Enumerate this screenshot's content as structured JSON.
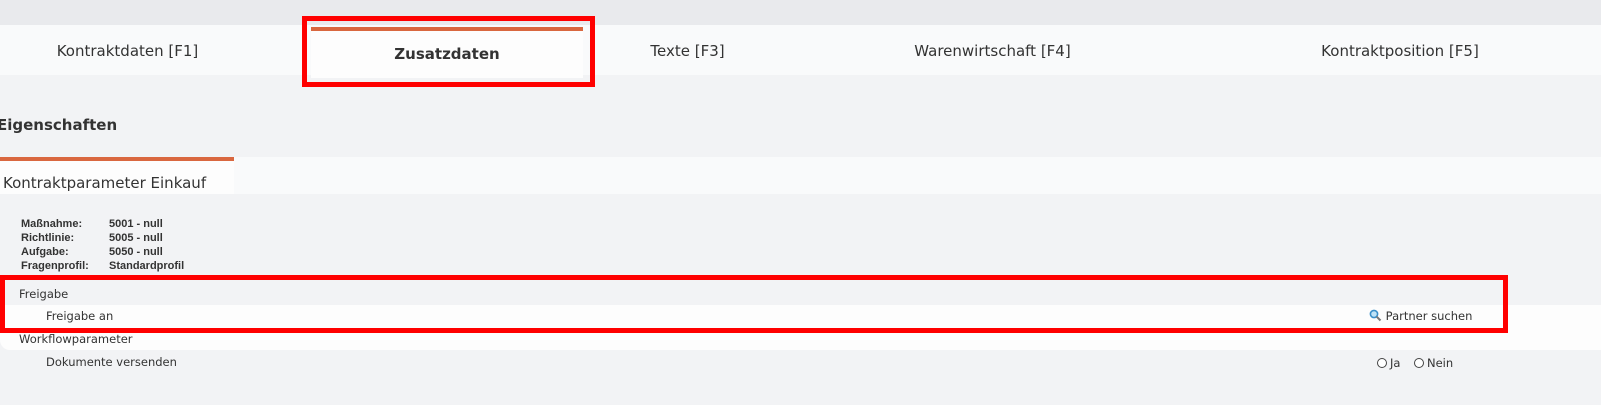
{
  "tabs": [
    {
      "label": "Kontraktdaten [F1]",
      "active": false
    },
    {
      "label": "Zusatzdaten",
      "active": true
    },
    {
      "label": "Texte [F3]",
      "active": false
    },
    {
      "label": "Warenwirtschaft [F4]",
      "active": false
    },
    {
      "label": "Kontraktposition [F5]",
      "active": false
    }
  ],
  "section_title": "Eigenschaften",
  "subtab": {
    "label": "Kontraktparameter Einkauf"
  },
  "properties": [
    {
      "key": "Maßnahme:",
      "value": "5001 - null"
    },
    {
      "key": "Richtlinie:",
      "value": "5005 - null"
    },
    {
      "key": "Aufgabe:",
      "value": "5050 - null"
    },
    {
      "key": "Fragenprofil:",
      "value": "Standardprofil"
    }
  ],
  "freigabe": {
    "section_label": "Freigabe",
    "row_label": "Freigabe an",
    "partner_search": {
      "icon": "magnifier-icon",
      "label": "Partner suchen"
    }
  },
  "workflow": {
    "section_label": "Workflowparameter",
    "row_label": "Dokumente versenden",
    "options": [
      {
        "label": "Ja",
        "selected": false
      },
      {
        "label": "Nein",
        "selected": false
      }
    ]
  },
  "colors": {
    "accent": "#d9673f",
    "highlight": "#ff0000",
    "background": "#f2f3f5"
  }
}
